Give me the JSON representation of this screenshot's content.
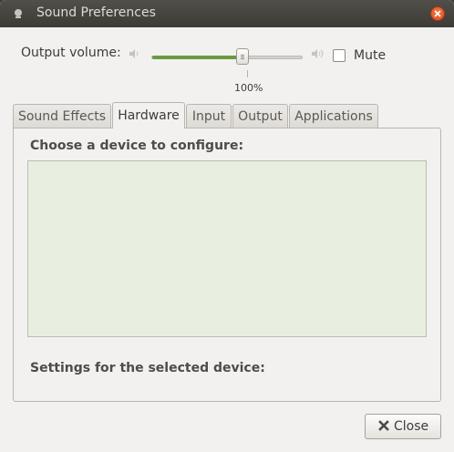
{
  "window": {
    "title": "Sound Preferences"
  },
  "volume": {
    "label": "Output volume:",
    "percent_text": "100%",
    "level": 0.6
  },
  "mute": {
    "label": "Mute",
    "checked": false
  },
  "tabs": [
    {
      "label": "Sound Effects"
    },
    {
      "label": "Hardware"
    },
    {
      "label": "Input"
    },
    {
      "label": "Output"
    },
    {
      "label": "Applications"
    }
  ],
  "active_tab": "Hardware",
  "hardware": {
    "choose_label": "Choose a device to configure:",
    "settings_label": "Settings for the selected device:"
  },
  "footer": {
    "close_label": "Close"
  },
  "colors": {
    "accent": "#6b9a3e",
    "titlebar": "#3c3b37",
    "close_button": "#df4a16",
    "device_list_bg": "#e8efe0"
  },
  "icons": {
    "window": "app-icon",
    "close": "close-icon",
    "speaker_low": "speaker-low-icon",
    "speaker_high": "speaker-high-icon",
    "close_button": "x-icon"
  }
}
